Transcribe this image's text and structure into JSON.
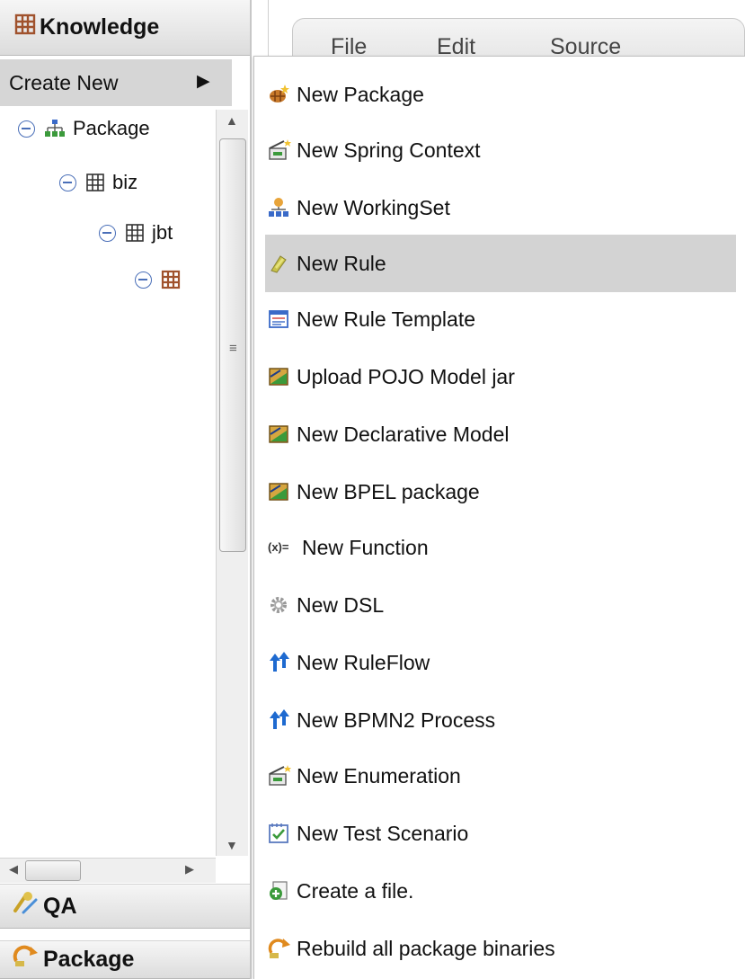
{
  "left_panel": {
    "knowledge_header": "Knowledge",
    "create_new": "Create New",
    "tree": {
      "root_label": "Package",
      "child_label": "biz",
      "grandchild_label": "jbt"
    },
    "qa_header": "QA",
    "package_header": "Package"
  },
  "editor": {
    "menu_file": "File",
    "menu_edit": "Edit",
    "menu_source": "Source"
  },
  "context_menu": {
    "items": [
      {
        "label": "New Package",
        "icon": "new-package-icon"
      },
      {
        "label": "New Spring Context",
        "icon": "spring-context-icon"
      },
      {
        "label": "New WorkingSet",
        "icon": "working-set-icon"
      },
      {
        "label": "New Rule",
        "icon": "rule-icon",
        "highlighted": true
      },
      {
        "label": "New Rule Template",
        "icon": "rule-template-icon"
      },
      {
        "label": "Upload POJO Model jar",
        "icon": "model-jar-icon"
      },
      {
        "label": "New Declarative Model",
        "icon": "declarative-model-icon"
      },
      {
        "label": "New BPEL package",
        "icon": "bpel-package-icon"
      },
      {
        "label": "New Function",
        "icon": "function-icon"
      },
      {
        "label": "New DSL",
        "icon": "dsl-icon"
      },
      {
        "label": "New RuleFlow",
        "icon": "ruleflow-icon"
      },
      {
        "label": "New BPMN2 Process",
        "icon": "bpmn2-process-icon"
      },
      {
        "label": "New Enumeration",
        "icon": "enumeration-icon"
      },
      {
        "label": "New Test Scenario",
        "icon": "test-scenario-icon"
      },
      {
        "label": "Create a file.",
        "icon": "create-file-icon"
      },
      {
        "label": "Rebuild all package binaries",
        "icon": "rebuild-icon"
      }
    ]
  },
  "colors": {
    "menu_highlight": "#d3d3d3",
    "header_gradient_top": "#f6f6f6",
    "header_gradient_bottom": "#dcdcdc",
    "tree_collapse_blue": "#4a6fb8",
    "package_icon_brown": "#a0522d",
    "package_icon_orange": "#d2691e"
  }
}
